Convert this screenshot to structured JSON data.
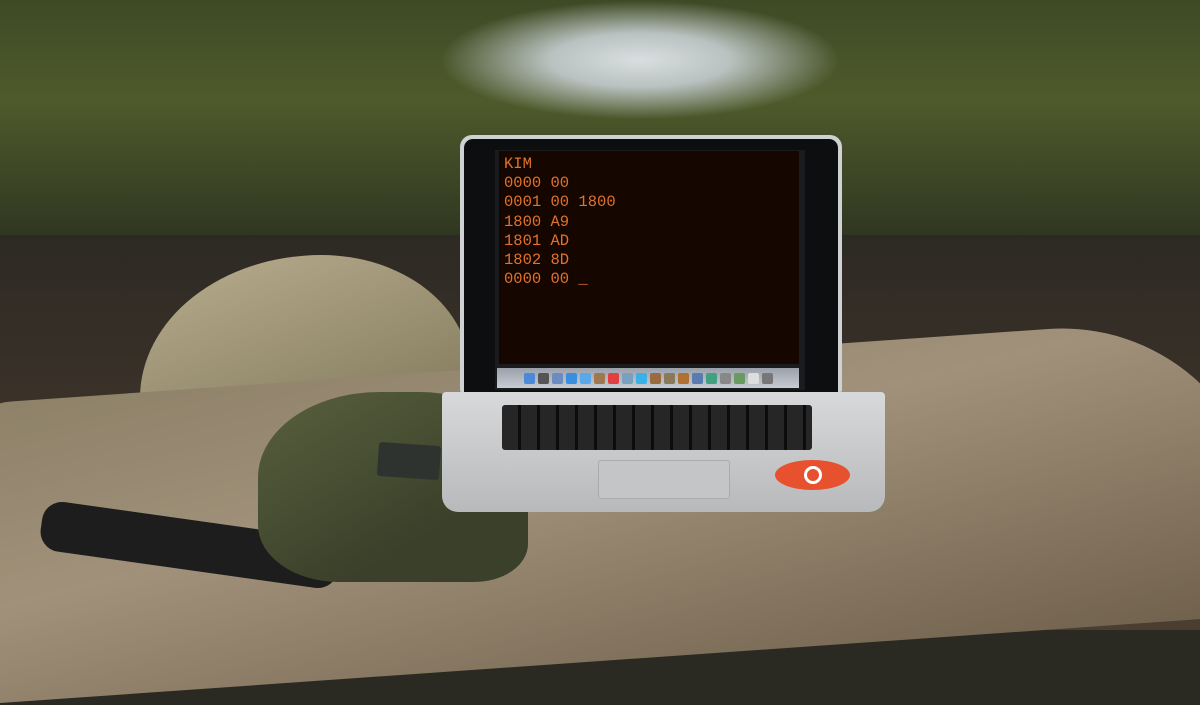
{
  "terminal": {
    "lines": [
      "KIM",
      "0000 00",
      "0001 00 1800",
      "1800 A9",
      "1801 AD",
      "1802 8D",
      "0000 00 _"
    ],
    "text_color": "#e0722c",
    "background_color": "#160600"
  },
  "dock": {
    "icons": [
      "finder-icon",
      "launchpad-icon",
      "preview-icon",
      "safari-icon",
      "ichat-icon",
      "address-book-icon",
      "calendar-icon",
      "photo-icon",
      "itunes-icon",
      "photo-booth-icon",
      "imovie-icon",
      "garageband-icon",
      "dashboard-icon",
      "time-machine-icon",
      "system-preferences-icon",
      "iphoto-icon",
      "documents-icon",
      "trash-icon"
    ]
  }
}
